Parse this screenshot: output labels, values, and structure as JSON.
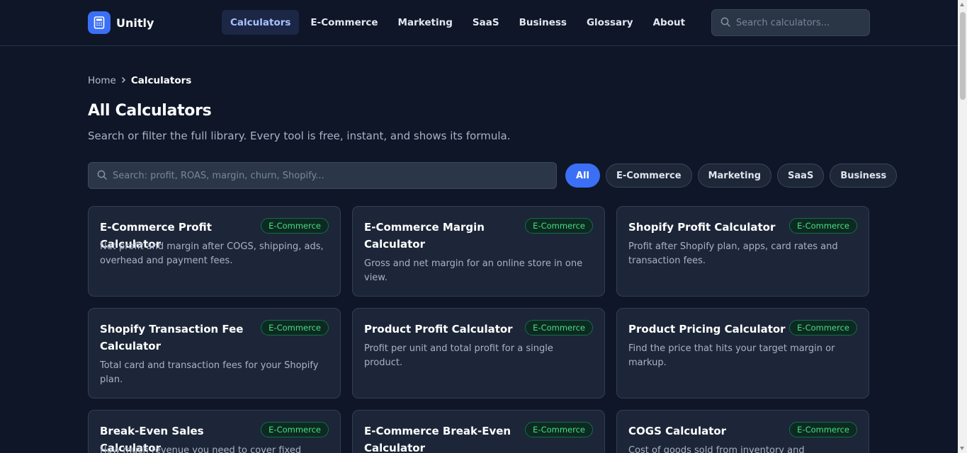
{
  "brand": {
    "name": "Unitly",
    "logo_icon": "calculator-icon",
    "accent": "#3b6ff5"
  },
  "nav": {
    "items": [
      {
        "label": "Calculators",
        "active": true
      },
      {
        "label": "E-Commerce"
      },
      {
        "label": "Marketing"
      },
      {
        "label": "SaaS"
      },
      {
        "label": "Business"
      },
      {
        "label": "Glossary"
      },
      {
        "label": "About"
      }
    ],
    "search_placeholder": "Search calculators..."
  },
  "breadcrumb": {
    "home": "Home",
    "current": "Calculators"
  },
  "page": {
    "title": "All Calculators",
    "subtitle": "Search or filter the full library. Every tool is free, instant, and shows its formula.",
    "search_placeholder": "Search: profit, ROAS, margin, churn, Shopify..."
  },
  "filters": [
    "All",
    "E-Commerce",
    "Marketing",
    "SaaS",
    "Business"
  ],
  "active_filter": "All",
  "cards": [
    {
      "title": "E-Commerce Profit Calculator",
      "badge": "E-Commerce",
      "desc": "Net profit and margin after COGS, shipping, ads, overhead and payment fees."
    },
    {
      "title": "E-Commerce Margin Calculator",
      "badge": "E-Commerce",
      "desc": "Gross and net margin for an online store in one view."
    },
    {
      "title": "Shopify Profit Calculator",
      "badge": "E-Commerce",
      "desc": "Profit after Shopify plan, apps, card rates and transaction fees."
    },
    {
      "title": "Shopify Transaction Fee Calculator",
      "badge": "E-Commerce",
      "desc": "Total card and transaction fees for your Shopify plan."
    },
    {
      "title": "Product Profit Calculator",
      "badge": "E-Commerce",
      "desc": "Profit per unit and total profit for a single product."
    },
    {
      "title": "Product Pricing Calculator",
      "badge": "E-Commerce",
      "desc": "Find the price that hits your target margin or markup."
    },
    {
      "title": "Break-Even Sales Calculator",
      "badge": "E-Commerce",
      "desc": "How much revenue you need to cover fixed costs."
    },
    {
      "title": "E-Commerce Break-Even Calculator",
      "badge": "E-Commerce",
      "desc": ""
    },
    {
      "title": "COGS Calculator",
      "badge": "E-Commerce",
      "desc": "Cost of goods sold from inventory and purchases."
    }
  ]
}
